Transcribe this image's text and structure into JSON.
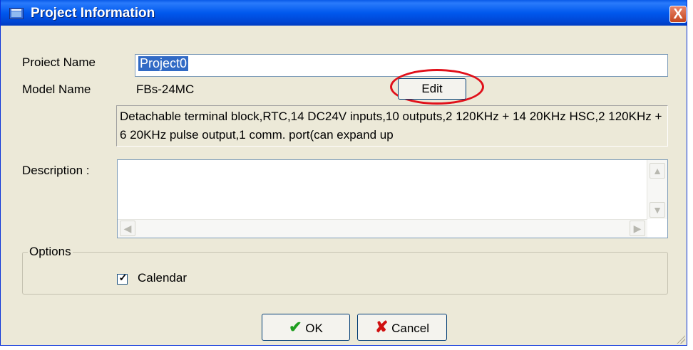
{
  "window": {
    "title": "Project Information",
    "close_glyph": "X"
  },
  "project_name": {
    "label": "Proiect Name",
    "value": "Project0"
  },
  "model_name": {
    "label": "Model Name",
    "value": "FBs-24MC",
    "edit_label": "Edit"
  },
  "model_info": {
    "text": "Detachable terminal block,RTC,14 DC24V inputs,10 outputs,2  120KHz + 14 20KHz HSC,2  120KHz  + 6  20KHz pulse output,1 comm. port(can expand up"
  },
  "description": {
    "label": "Description :",
    "value": ""
  },
  "options": {
    "legend": "Options",
    "calendar_label": "Calendar",
    "calendar_checked": true
  },
  "buttons": {
    "ok_label": "OK",
    "cancel_label": "Cancel"
  },
  "colors": {
    "title_bar": "#0058ee",
    "dialog_bg": "#ece9d8",
    "highlight_circle": "#e0101a",
    "ok_icon": "#1f9e1f",
    "cancel_icon": "#d01010"
  },
  "icons": {
    "app": "app-window-icon",
    "close": "close-icon",
    "ok": "checkmark-icon",
    "cancel": "x-mark-icon"
  }
}
